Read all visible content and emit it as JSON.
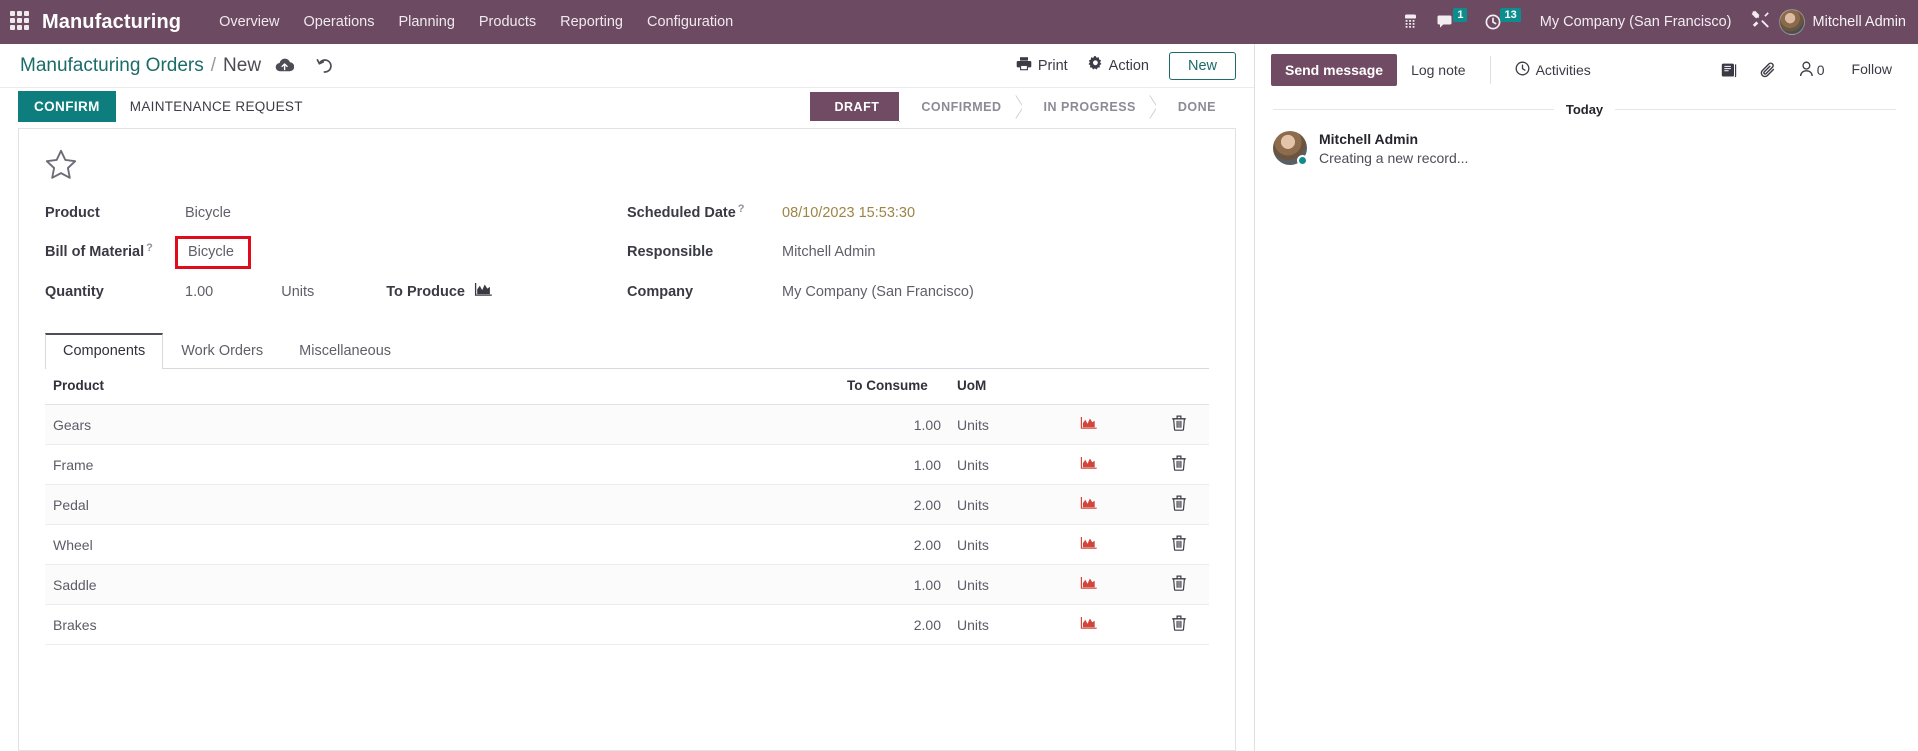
{
  "navbar": {
    "apps_icon": "apps-grid-icon",
    "brand": "Manufacturing",
    "menus": [
      {
        "label": "Overview"
      },
      {
        "label": "Operations"
      },
      {
        "label": "Planning"
      },
      {
        "label": "Products"
      },
      {
        "label": "Reporting"
      },
      {
        "label": "Configuration"
      }
    ],
    "voip_icon": "phone-dialpad-icon",
    "messages_icon": "chat-bubble-icon",
    "messages_count": "1",
    "activities_icon": "clock-icon",
    "activities_count": "13",
    "company": "My Company (San Francisco)",
    "debug_icon": "tools-icon",
    "user": "Mitchell Admin",
    "badge_color": "#0d8e8e",
    "bar_color": "#6b4a62"
  },
  "control_panel": {
    "breadcrumb_root": "Manufacturing Orders",
    "breadcrumb_sep": "/",
    "breadcrumb_current": "New",
    "save_icon": "cloud-upload-icon",
    "discard_icon": "undo-icon",
    "print_label": "Print",
    "print_icon": "printer-icon",
    "action_label": "Action",
    "action_icon": "gear-icon",
    "new_label": "New"
  },
  "status_row": {
    "confirm_label": "CONFIRM",
    "maintenance_label": "MAINTENANCE REQUEST",
    "stages": [
      {
        "label": "DRAFT",
        "active": true
      },
      {
        "label": "CONFIRMED",
        "active": false
      },
      {
        "label": "IN PROGRESS",
        "active": false
      },
      {
        "label": "DONE",
        "active": false
      }
    ],
    "active_color": "#714b63"
  },
  "form": {
    "star_icon": "star-outline-icon",
    "left": {
      "product_label": "Product",
      "product_value": "Bicycle",
      "bom_label": "Bill of Material",
      "bom_help": "?",
      "bom_value": "Bicycle",
      "bom_highlight_color": "#e00c1c",
      "quantity_label": "Quantity",
      "quantity_value": "1.00",
      "quantity_uom": "Units",
      "to_produce_label": "To Produce",
      "to_produce_icon": "area-chart-icon"
    },
    "right": {
      "scheduled_label": "Scheduled Date",
      "scheduled_help": "?",
      "scheduled_value": "08/10/2023 15:53:30",
      "scheduled_color": "#9c8546",
      "responsible_label": "Responsible",
      "responsible_value": "Mitchell Admin",
      "company_label": "Company",
      "company_value": "My Company (San Francisco)"
    }
  },
  "notebook": {
    "tabs": [
      {
        "label": "Components",
        "active": true
      },
      {
        "label": "Work Orders",
        "active": false
      },
      {
        "label": "Miscellaneous",
        "active": false
      }
    ],
    "table": {
      "headers": {
        "product": "Product",
        "to_consume": "To Consume",
        "uom": "UoM",
        "forecast": "",
        "delete": ""
      },
      "row_forecast_icon": "area-chart-icon",
      "row_delete_icon": "trash-icon",
      "rows": [
        {
          "product": "Gears",
          "to_consume": "1.00",
          "uom": "Units"
        },
        {
          "product": "Frame",
          "to_consume": "1.00",
          "uom": "Units"
        },
        {
          "product": "Pedal",
          "to_consume": "2.00",
          "uom": "Units"
        },
        {
          "product": "Wheel",
          "to_consume": "2.00",
          "uom": "Units"
        },
        {
          "product": "Saddle",
          "to_consume": "1.00",
          "uom": "Units"
        },
        {
          "product": "Brakes",
          "to_consume": "2.00",
          "uom": "Units"
        }
      ]
    }
  },
  "chatter": {
    "send_message_label": "Send message",
    "log_note_label": "Log note",
    "activities_label": "Activities",
    "activities_icon": "clock-icon",
    "knowledge_icon": "book-icon",
    "attachment_icon": "paperclip-icon",
    "followers_icon": "user-icon",
    "followers_count": "0",
    "follow_label": "Follow",
    "day_separator": "Today",
    "messages": [
      {
        "author": "Mitchell Admin",
        "body": "Creating a new record...",
        "avatar": "user-avatar",
        "online": true
      }
    ]
  }
}
